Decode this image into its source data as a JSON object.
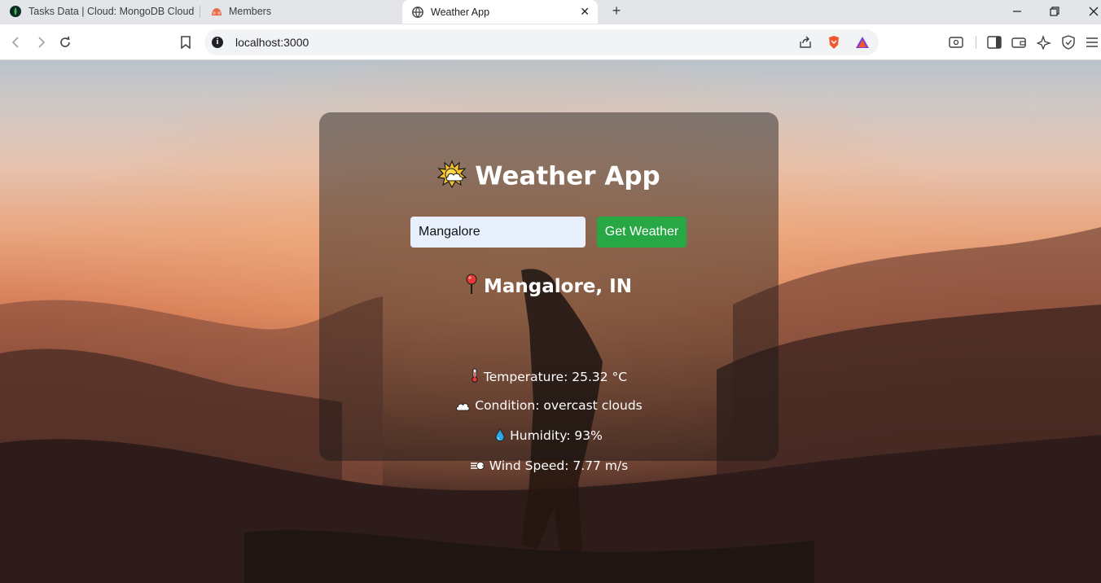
{
  "browser": {
    "tabs": [
      {
        "label": "Tasks Data | Cloud: MongoDB Cloud",
        "icon": "mongodb-leaf-icon"
      },
      {
        "label": "Members",
        "icon": "members-icon"
      },
      {
        "label": "Weather App",
        "icon": "globe-icon",
        "active": true
      }
    ],
    "url": "localhost:3000"
  },
  "app": {
    "title": "Weather App",
    "title_icon": "sun-behind-cloud-icon",
    "search": {
      "value": "Mangalore"
    },
    "button_label": "Get Weather",
    "location": "Mangalore, IN",
    "location_icon": "round-pushpin-icon",
    "stats": {
      "temperature": "Temperature: 25.32 °C",
      "condition": "Condition: overcast clouds",
      "humidity": "Humidity: 93%",
      "wind": "Wind Speed: 7.77 m/s"
    }
  },
  "colors": {
    "button": "#28a745",
    "input_bg": "#e8f0fe",
    "card_overlay": "rgba(25,22,22,0.46)"
  }
}
